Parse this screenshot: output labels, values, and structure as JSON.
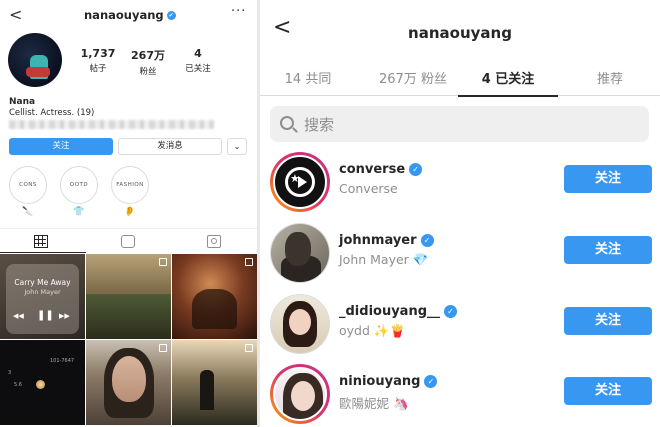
{
  "left": {
    "header": {
      "back": "<",
      "username": "nanaouyang",
      "verified": "✔",
      "more": "···"
    },
    "stats": [
      {
        "num": "1,737",
        "label": "帖子"
      },
      {
        "num": "267万",
        "label": "粉丝"
      },
      {
        "num": "4",
        "label": "已关注"
      }
    ],
    "display_name": "Nana",
    "bio": "Cellist. Actress. (19)",
    "buttons": {
      "follow": "关注",
      "message": "发消息",
      "dropdown": "⌄"
    },
    "highlights": [
      {
        "label": "CONS",
        "emoji": "🔪"
      },
      {
        "label": "OOTD",
        "emoji": "👕"
      },
      {
        "label": "FASHION",
        "emoji": "👂"
      }
    ],
    "posts": {
      "music_title": "Carry Me Away",
      "music_artist": "John Mayer",
      "prev": "◀◀",
      "pause": "❚❚",
      "next": "▶▶",
      "night_labels": [
        "3",
        "5.6",
        "101-7647"
      ]
    }
  },
  "right": {
    "back": "<",
    "title": "nanaouyang",
    "tabs": [
      {
        "label": "14 共同"
      },
      {
        "label": "267万 粉丝"
      },
      {
        "label": "4 已关注"
      },
      {
        "label": "推荐"
      }
    ],
    "search_placeholder": "搜索",
    "users": [
      {
        "username": "converse",
        "subtitle": "Converse",
        "badge": "✓",
        "button": "关注"
      },
      {
        "username": "johnmayer",
        "subtitle": "John Mayer 💎",
        "badge": "✓",
        "button": "关注"
      },
      {
        "username": "_didiouyang__",
        "subtitle": "oydd ✨🍟",
        "badge": "✓",
        "button": "关注"
      },
      {
        "username": "niniouyang",
        "subtitle": "歐陽妮妮 🦄",
        "badge": "✓",
        "button": "关注"
      }
    ]
  },
  "colors": {
    "accent": "#3897f0",
    "text": "#262626",
    "muted": "#8e8e8e"
  }
}
